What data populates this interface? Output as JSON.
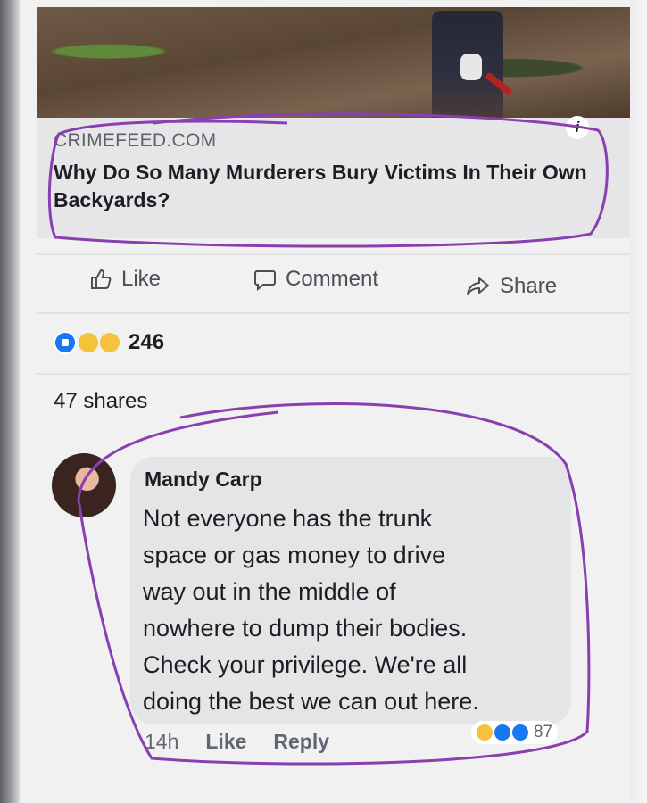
{
  "post": {
    "link_domain": "CRIMEFEED.COM",
    "link_headline": "Why Do So Many Murderers Bury Victims In Their Own Backyards?",
    "info_icon": "i"
  },
  "actions": {
    "like_label": "Like",
    "comment_label": "Comment",
    "share_label": "Share"
  },
  "reactions": {
    "count": "246",
    "icons": [
      "like-icon",
      "wow-icon",
      "sad-icon"
    ]
  },
  "shares": {
    "text": "47 shares"
  },
  "comment": {
    "author": "Mandy Carp",
    "text": "Not everyone has the trunk\nspace or gas money to drive\nway out in the middle of\nnowhere to dump their bodies.\nCheck your privilege. We're all\ndoing the best we can out here.",
    "time": "14h",
    "like_label": "Like",
    "reply_label": "Reply",
    "reaction_count": "87",
    "reaction_icons": [
      "haha-icon",
      "like-icon",
      "love-icon"
    ]
  },
  "colors": {
    "accent_blue": "#1877f2",
    "marker_purple": "#8a3fb0",
    "text_primary": "#1c1e21",
    "text_secondary": "#606770"
  }
}
